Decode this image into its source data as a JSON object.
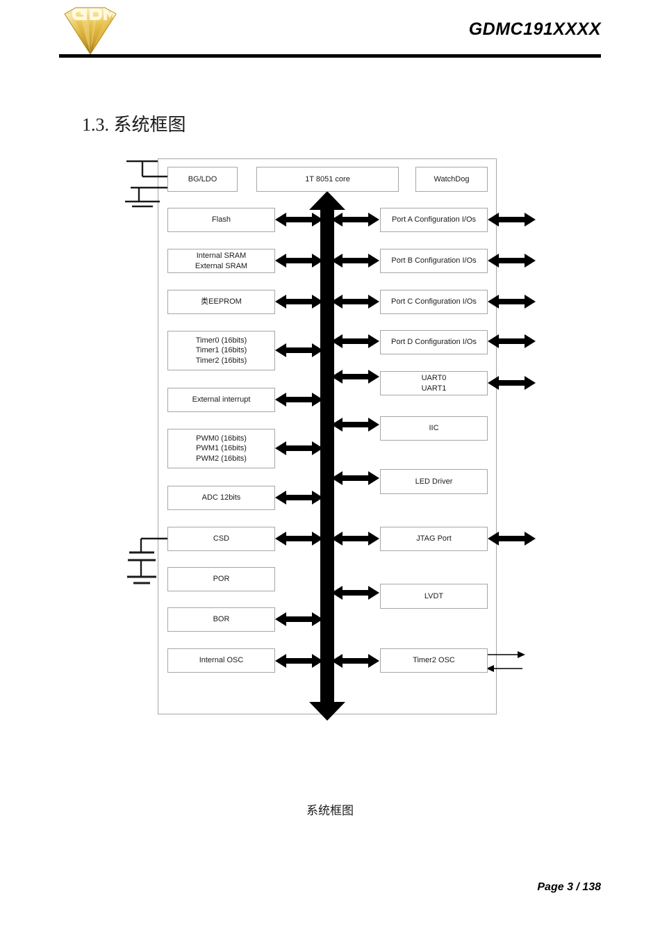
{
  "header": {
    "title": "GDMC191XXXX",
    "logo_icon": "gdm-diamond-logo-icon",
    "logo_colors": {
      "gold_light": "#f7e08a",
      "gold": "#d9a823",
      "gold_dark": "#8a6410",
      "cream": "#fdf6d8"
    }
  },
  "section": {
    "title": "1.3. 系统框图"
  },
  "figure": {
    "caption": "系统框图",
    "bus_label": "",
    "colors": {
      "block_border": "#a6a6a6",
      "arrow": "#000000",
      "text": "#1a1a1a",
      "chip_border": "#a6a6a6"
    },
    "top_blocks": [
      {
        "id": "bg-ldo",
        "label": "BG/LDO"
      },
      {
        "id": "core",
        "label": "1T 8051 core"
      },
      {
        "id": "watchdog",
        "label": "WatchDog"
      }
    ],
    "left_blocks": [
      {
        "id": "flash",
        "label": "Flash",
        "lines": [
          "Flash"
        ],
        "bus_arrow": true
      },
      {
        "id": "sram",
        "label": "Internal SRAM / External SRAM",
        "lines": [
          "Internal SRAM",
          "External SRAM"
        ],
        "bus_arrow": true
      },
      {
        "id": "eeprom",
        "label": "类EEPROM",
        "lines": [
          "类EEPROM"
        ],
        "bus_arrow": true
      },
      {
        "id": "timers",
        "label": "Timer0/1/2 (16bits)",
        "lines": [
          "Timer0 (16bits)",
          "Timer1 (16bits)",
          "Timer2 (16bits)"
        ],
        "bus_arrow": true
      },
      {
        "id": "external-interrupt",
        "label": "External interrupt",
        "lines": [
          "External interrupt"
        ],
        "bus_arrow": true
      },
      {
        "id": "pwm",
        "label": "PWM0/1/2 (16bits)",
        "lines": [
          "PWM0 (16bits)",
          "PWM1 (16bits)",
          "PWM2 (16bits)"
        ],
        "bus_arrow": true
      },
      {
        "id": "adc",
        "label": "ADC 12bits",
        "lines": [
          "ADC 12bits"
        ],
        "bus_arrow": true
      },
      {
        "id": "csd",
        "label": "CSD",
        "lines": [
          "CSD"
        ],
        "bus_arrow": true
      },
      {
        "id": "por",
        "label": "POR",
        "lines": [
          "POR"
        ],
        "bus_arrow": false
      },
      {
        "id": "bor",
        "label": "BOR",
        "lines": [
          "BOR"
        ],
        "bus_arrow": true
      },
      {
        "id": "internal-osc",
        "label": "Internal OSC",
        "lines": [
          "Internal OSC"
        ],
        "bus_arrow": true
      }
    ],
    "right_blocks": [
      {
        "id": "port-a",
        "label": "Port A Configuration I/Os",
        "lines": [
          "Port A Configuration I/Os"
        ],
        "bus_arrow": true,
        "external_arrow": "double"
      },
      {
        "id": "port-b",
        "label": "Port B Configuration I/Os",
        "lines": [
          "Port B Configuration I/Os"
        ],
        "bus_arrow": true,
        "external_arrow": "double"
      },
      {
        "id": "port-c",
        "label": "Port C Configuration I/Os",
        "lines": [
          "Port C Configuration I/Os"
        ],
        "bus_arrow": true,
        "external_arrow": "double"
      },
      {
        "id": "port-d",
        "label": "Port D Configuration I/Os",
        "lines": [
          "Port D Configuration I/Os"
        ],
        "bus_arrow": true,
        "external_arrow": "double"
      },
      {
        "id": "uart",
        "label": "UART0 / UART1",
        "lines": [
          "UART0",
          "UART1"
        ],
        "bus_arrow": true,
        "external_arrow": "double"
      },
      {
        "id": "iic",
        "label": "IIC",
        "lines": [
          "IIC"
        ],
        "bus_arrow": true,
        "external_arrow": "none"
      },
      {
        "id": "led-driver",
        "label": "LED Driver",
        "lines": [
          "LED Driver"
        ],
        "bus_arrow": true,
        "external_arrow": "none"
      },
      {
        "id": "jtag",
        "label": "JTAG Port",
        "lines": [
          "JTAG Port"
        ],
        "bus_arrow": true,
        "external_arrow": "double"
      },
      {
        "id": "lvdt",
        "label": "LVDT",
        "lines": [
          "LVDT"
        ],
        "bus_arrow": true,
        "external_arrow": "none"
      },
      {
        "id": "timer2-osc",
        "label": "Timer2 OSC",
        "lines": [
          "Timer2 OSC"
        ],
        "bus_arrow": true,
        "external_arrow": "thin-pair"
      }
    ],
    "power_symbols": [
      {
        "id": "vdd-gnd-top",
        "attached_to": "bg-ldo",
        "type": "supply-ground-icon"
      },
      {
        "id": "cap-gnd-csd",
        "attached_to": "csd",
        "type": "capacitor-ground-icon"
      }
    ]
  },
  "footer": {
    "page_label": "Page 3 / 138"
  }
}
